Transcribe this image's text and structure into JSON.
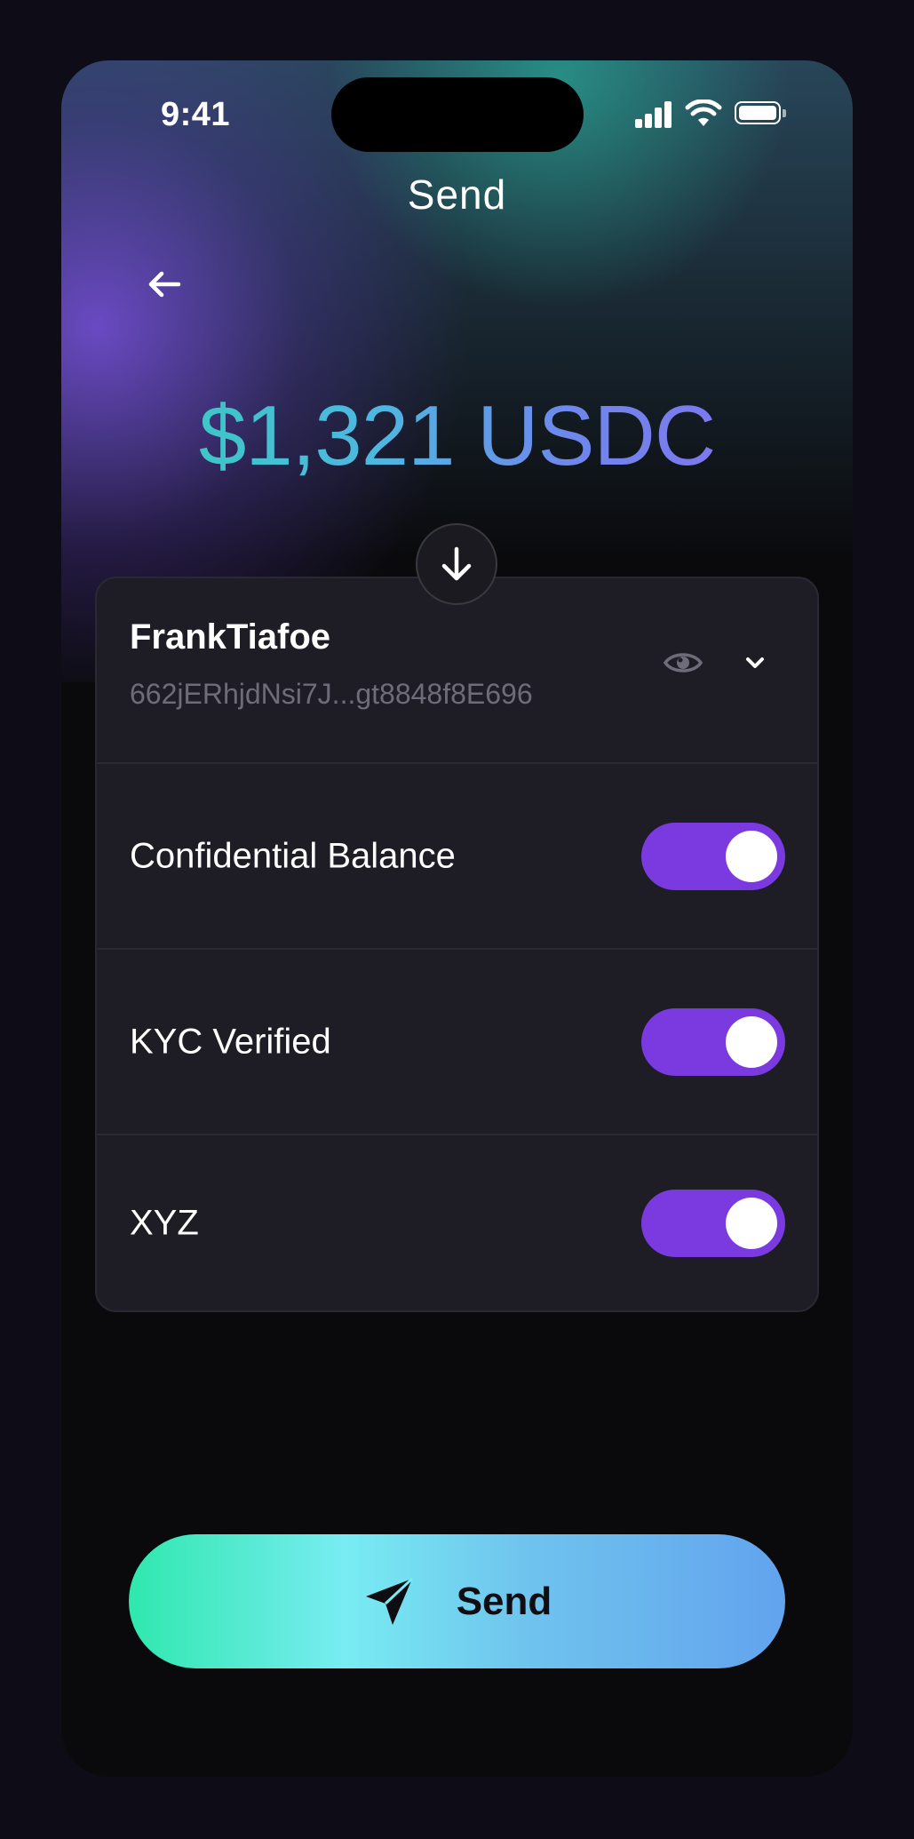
{
  "status_bar": {
    "time": "9:41"
  },
  "header": {
    "title": "Send"
  },
  "amount": {
    "display": "$1,321 USDC"
  },
  "account": {
    "name": "FrankTiafoe",
    "address": "662jERhjdNsi7J...gt8848f8E696"
  },
  "options": [
    {
      "label": "Confidential Balance",
      "enabled": true
    },
    {
      "label": "KYC Verified",
      "enabled": true
    },
    {
      "label": "XYZ",
      "enabled": true
    }
  ],
  "send_button": {
    "label": "Send"
  },
  "colors": {
    "toggle_on": "#7a3ae0",
    "amount_gradient_start": "#2fd3b4",
    "amount_gradient_end": "#8a6cf0",
    "button_gradient_start": "#2fe8ae",
    "button_gradient_end": "#62a3ee",
    "card_background": "#1e1c24"
  },
  "icons": [
    "back-arrow-icon",
    "arrow-down-icon",
    "eye-icon",
    "chevron-down-icon",
    "paper-plane-icon",
    "signal-icon",
    "wifi-icon",
    "battery-icon"
  ]
}
